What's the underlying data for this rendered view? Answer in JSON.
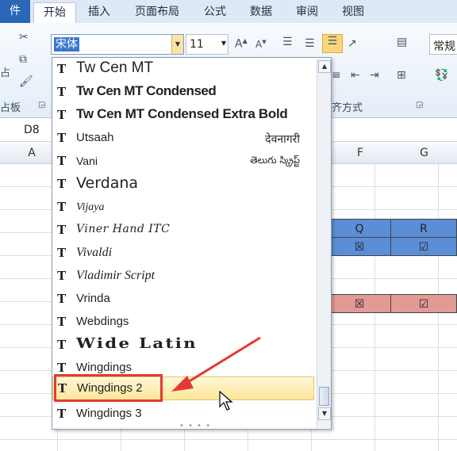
{
  "tabs": [
    {
      "label": "件",
      "key": "file"
    },
    {
      "label": "开始",
      "key": "home"
    },
    {
      "label": "插入",
      "key": "insert"
    },
    {
      "label": "页面布局",
      "key": "layout"
    },
    {
      "label": "公式",
      "key": "formulas"
    },
    {
      "label": "数据",
      "key": "data"
    },
    {
      "label": "审阅",
      "key": "review"
    },
    {
      "label": "视图",
      "key": "view"
    }
  ],
  "ribbon": {
    "font_name": "宋体",
    "font_size": "11",
    "number_format": "常规",
    "paste_label": "占",
    "clipboard_label": "占板",
    "alignment_label": "齐方式"
  },
  "name_box": "D8",
  "columns": [
    "A",
    "F",
    "G"
  ],
  "cells": {
    "q": "Q",
    "r": "R",
    "box_x": "☒",
    "box_check": "☑",
    "pink_x": "☒",
    "pink_check": "☑"
  },
  "fonts": [
    {
      "name": "Tw Cen MT",
      "sample": ""
    },
    {
      "name": "Tw Cen MT Condensed",
      "sample": ""
    },
    {
      "name": "Tw Cen MT Condensed Extra Bold",
      "sample": ""
    },
    {
      "name": "Utsaah",
      "sample": "देवनागरी"
    },
    {
      "name": "Vani",
      "sample": "తెలుగు స్క్రిప్ట్"
    },
    {
      "name": "Verdana",
      "sample": ""
    },
    {
      "name": "Vijaya",
      "sample": ""
    },
    {
      "name": "Viner Hand ITC",
      "sample": ""
    },
    {
      "name": "Vivaldi",
      "sample": ""
    },
    {
      "name": "Vladimir Script",
      "sample": ""
    },
    {
      "name": "Vrinda",
      "sample": ""
    },
    {
      "name": "Webdings",
      "sample": ""
    },
    {
      "name": "Wide Latin",
      "sample": ""
    },
    {
      "name": "Wingdings",
      "sample": ""
    },
    {
      "name": "Wingdings 2",
      "sample": ""
    },
    {
      "name": "Wingdings 3",
      "sample": ""
    }
  ],
  "selected_font": "Wingdings 2",
  "colors": {
    "highlight_box": "#e23a32",
    "blue_cell": "#5b8ed6",
    "pink_cell": "#e29a94"
  }
}
